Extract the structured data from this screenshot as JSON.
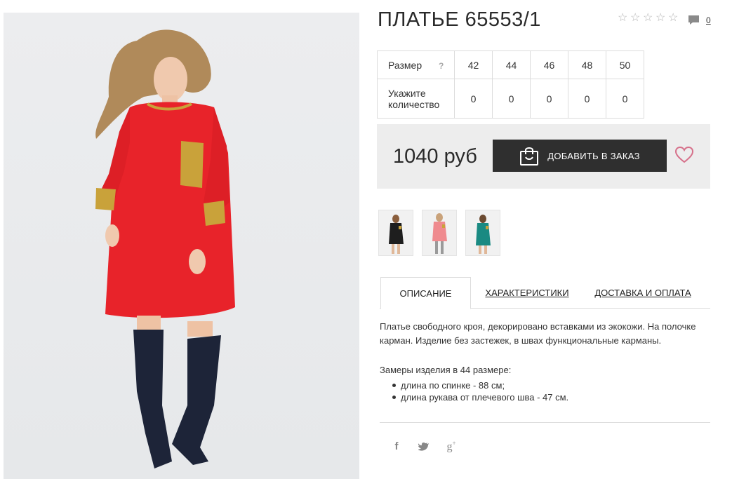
{
  "product": {
    "title": "ПЛАТЬЕ 65553/1",
    "rating_stars": 5,
    "comments_count": "0"
  },
  "sizes": {
    "size_label": "Размер",
    "help_label": "?",
    "qty_label": "Укажите количество",
    "values": [
      "42",
      "44",
      "46",
      "48",
      "50"
    ],
    "quantities": [
      "0",
      "0",
      "0",
      "0",
      "0"
    ]
  },
  "order": {
    "price": "1040 руб",
    "add_button_label": "ДОБАВИТЬ В ЗАКАЗ"
  },
  "thumbnails": [
    "black-dress",
    "pink-dress",
    "teal-dress"
  ],
  "tabs": [
    {
      "label": "ОПИСАНИЕ",
      "active": true
    },
    {
      "label": "ХАРАКТЕРИСТИКИ",
      "active": false
    },
    {
      "label": "ДОСТАВКА И ОПЛАТА",
      "active": false
    }
  ],
  "description": {
    "text": "Платье свободного кроя, декорировано вставками из экокожи. На полочке карман. Изделие без застежек, в швах функциональные карманы.",
    "measures_title": "Замеры изделия в 44 размере:",
    "measures": [
      "длина по спинке - 88 см;",
      "длина рукава от плечевого шва - 47 см."
    ]
  },
  "social": [
    "f",
    "twitter",
    "g+"
  ],
  "colors": {
    "dress": "#e8232a",
    "gold": "#c9a23a",
    "button": "#2f2f2f",
    "heart": "#d6708a"
  }
}
